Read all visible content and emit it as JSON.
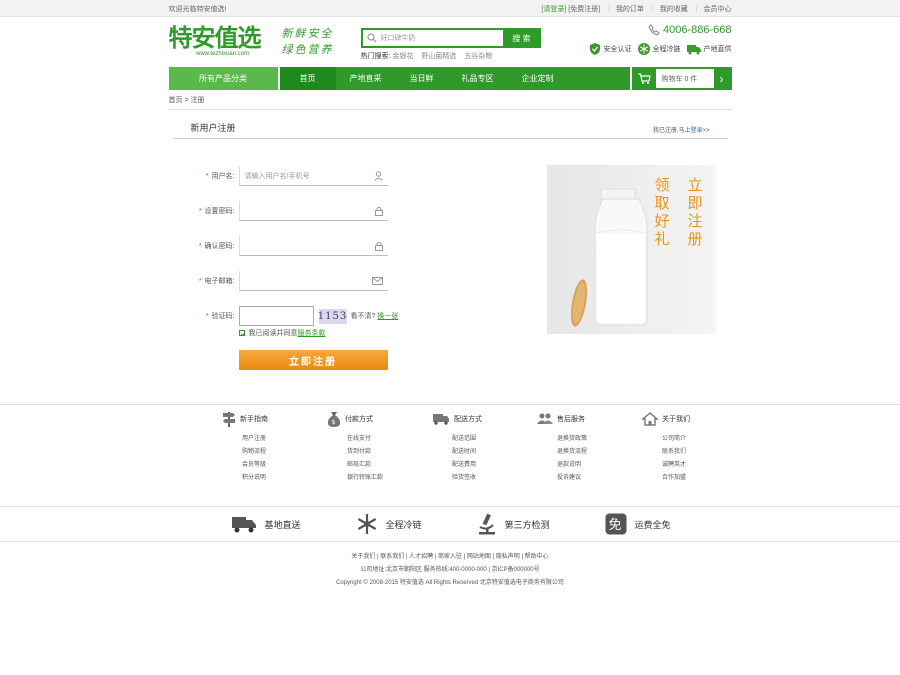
{
  "topbar": {
    "welcome": "欢迎光临特安值选!",
    "login": "[请登录]",
    "register": "[免费注册]",
    "my_orders": "我的订单",
    "favorites": "我的收藏",
    "member": "会员中心"
  },
  "header": {
    "logo_text": "特安值选",
    "logo_url": "www.tezhixuan.com",
    "slogan_line1": "新鲜安全",
    "slogan_line2": "绿色营养",
    "search_placeholder": "好口碑牛奶",
    "search_button": "搜 索",
    "hot_label": "热门搜索:",
    "hot_items": [
      "金银花",
      "野山菌精选",
      "五谷杂粮"
    ],
    "phone": "4006-886-668",
    "badges": [
      "安全认证",
      "全程冷链",
      "产地直供"
    ]
  },
  "nav": {
    "category": "所有产品分类",
    "items": [
      "首页",
      "产地直采",
      "当日鲜",
      "礼品专区",
      "企业定制"
    ],
    "cart": "购物车 0 件",
    "cart_arrow": "›"
  },
  "breadcrumb": "首页 > 注册",
  "register": {
    "title": "新用户注册",
    "has_account": "我已注册,马上",
    "login_link": "登录>>",
    "fields": [
      {
        "label": "用户名:",
        "placeholder": "请输入用户名/手机号"
      },
      {
        "label": "设置密码:",
        "placeholder": ""
      },
      {
        "label": "确认密码:",
        "placeholder": ""
      },
      {
        "label": "电子邮箱:",
        "placeholder": ""
      }
    ],
    "captcha_label": "验证码:",
    "captcha_code": "1153",
    "captcha_hint": "看不清?",
    "captcha_refresh": "换一张",
    "agree_text": "我已阅读并同意",
    "agree_link": "服务条款",
    "submit": "立即注册",
    "promo_col1": "立即注册",
    "promo_col2": "领取好礼"
  },
  "help": [
    {
      "title": "新手指南",
      "items": [
        "用户注册",
        "购物流程",
        "会员等级",
        "积分说明"
      ]
    },
    {
      "title": "付款方式",
      "items": [
        "在线支付",
        "货到付款",
        "邮局汇款",
        "银行转账汇款"
      ]
    },
    {
      "title": "配送方式",
      "items": [
        "配送范围",
        "配送时间",
        "配送费用",
        "验货签收"
      ]
    },
    {
      "title": "售后服务",
      "items": [
        "退换货政策",
        "退换货流程",
        "退款说明",
        "投诉建议"
      ]
    },
    {
      "title": "关于我们",
      "items": [
        "公司简介",
        "联系我们",
        "诚聘英才",
        "合作加盟"
      ]
    }
  ],
  "services": [
    "基地直送",
    "全程冷链",
    "第三方检测",
    "运费全免"
  ],
  "footer": {
    "links": "关于我们 | 联系我们 | 人才招聘 | 商家入驻 | 网站地图 | 隐私声明 | 帮助中心",
    "line2": "公司地址:北京市朝阳区 服务热线:400-0000-000 | 京ICP备000000号",
    "line3": "Copyright © 2008-2015 特安值选 All Rights Reserved 北京特安值选电子商务有限公司"
  }
}
